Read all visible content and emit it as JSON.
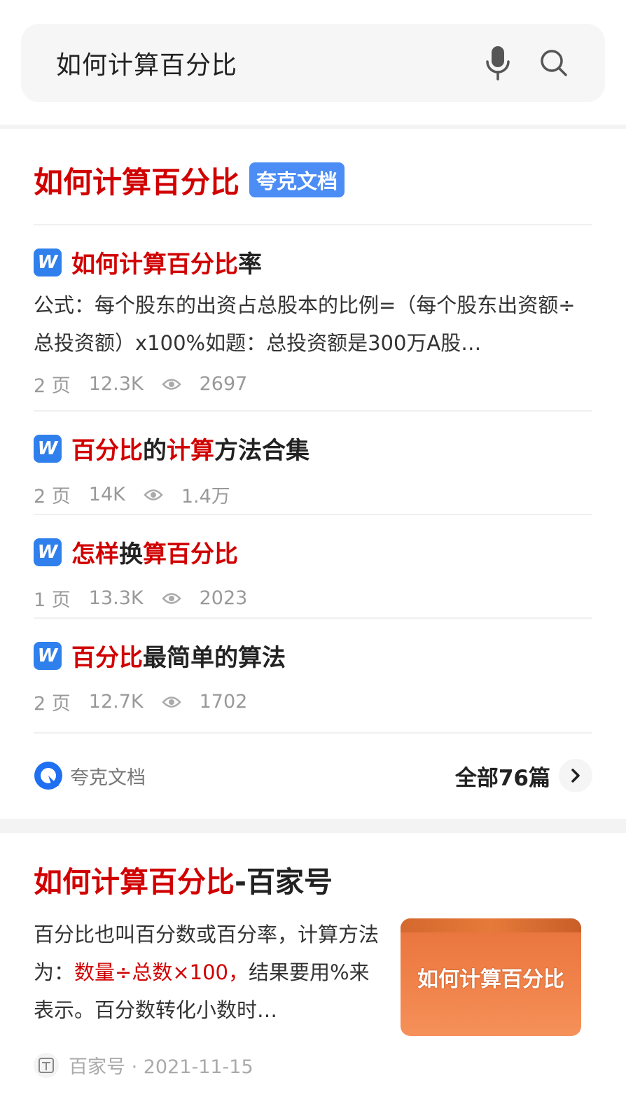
{
  "search": {
    "query": "如何计算百分比"
  },
  "card1": {
    "title": "如何计算百分比",
    "tag": "夸克文档",
    "docs": [
      {
        "title_parts": [
          {
            "text": "如何计算百分比",
            "hl": true
          },
          {
            "text": "率",
            "hl": false
          }
        ],
        "desc": "公式：每个股东的出资占总股本的比例=（每个股东出资额÷总投资额）x100%如题：总投资额是300万A股…",
        "pages": "2 页",
        "size": "12.3K",
        "views": "2697"
      },
      {
        "title_parts": [
          {
            "text": "百分比",
            "hl": true
          },
          {
            "text": "的",
            "hl": false
          },
          {
            "text": "计算",
            "hl": true
          },
          {
            "text": "方法合集",
            "hl": false
          }
        ],
        "pages": "2 页",
        "size": "14K",
        "views": "1.4万"
      },
      {
        "title_parts": [
          {
            "text": "怎样",
            "hl": true
          },
          {
            "text": "换",
            "hl": false
          },
          {
            "text": "算百分比",
            "hl": true
          }
        ],
        "pages": "1 页",
        "size": "13.3K",
        "views": "2023"
      },
      {
        "title_parts": [
          {
            "text": "百分比",
            "hl": true
          },
          {
            "text": "最简单的算法",
            "hl": false
          }
        ],
        "pages": "2 页",
        "size": "12.7K",
        "views": "1702"
      }
    ],
    "source": "夸克文档",
    "all_label": "全部76篇"
  },
  "card2": {
    "title_hl": "如何计算百分比",
    "title_rest": "-百家号",
    "desc_a": "百分比也叫百分数或百分率，计算方法为：",
    "desc_hl": "数量÷总数×100，",
    "desc_b": "结果要用%来表示。百分数转化小数时…",
    "thumb_text": "如何计算百分比",
    "source": "百家号 · 2021-11-15"
  },
  "colors": {
    "highlight": "#d10000",
    "tag": "#4b8cf5",
    "doc_icon": "#2f80ed"
  }
}
